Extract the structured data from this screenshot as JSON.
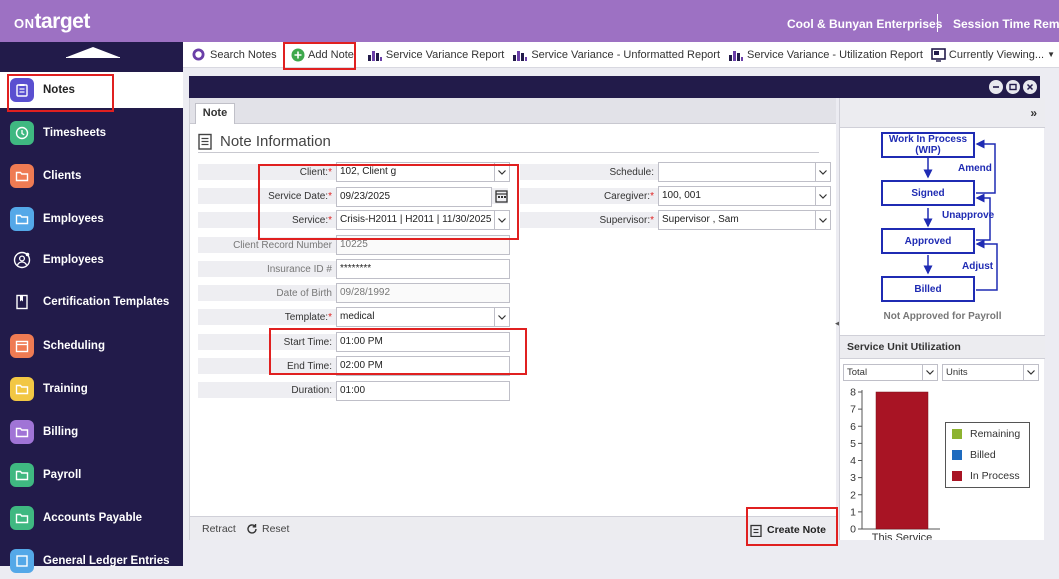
{
  "header": {
    "logo_on": "ON",
    "logo_target": "target",
    "company": "Cool & Bunyan Enterprises",
    "session": "Session Time Remai"
  },
  "sidebar": {
    "items": [
      {
        "label": "Notes",
        "color": "#5a4fd0"
      },
      {
        "label": "Timesheets",
        "color": "#3fb881"
      },
      {
        "label": "Clients",
        "color": "#ef7b53"
      },
      {
        "label": "Employees",
        "color": "#54a8e8"
      },
      {
        "label": "Employees",
        "sub": true
      },
      {
        "label": "Certification Templates",
        "sub": true
      },
      {
        "label": "Scheduling",
        "color": "#ef7b53"
      },
      {
        "label": "Training",
        "color": "#f2c744"
      },
      {
        "label": "Billing",
        "color": "#a074d6"
      },
      {
        "label": "Payroll",
        "color": "#3fb881"
      },
      {
        "label": "Accounts Payable",
        "color": "#3fb881"
      },
      {
        "label": "General Ledger Entries",
        "color": "#54a8e8"
      }
    ]
  },
  "toolbar": {
    "search_notes": "Search Notes",
    "add_note": "Add Note",
    "svc_variance": "Service Variance Report",
    "svc_unformatted": "Service Variance - Unformatted Report",
    "svc_utilization": "Service Variance - Utilization Report",
    "currently_viewing": "Currently Viewing..."
  },
  "form": {
    "tab": "Note",
    "title": "Note Information",
    "fields": {
      "client_label": "Client:",
      "client_value": "102, Client g",
      "service_date_label": "Service Date:",
      "service_date_value": "09/23/2025",
      "service_label": "Service:",
      "service_value": "Crisis-H2011 | H2011 | 11/30/2025",
      "client_record_label": "Client Record Number",
      "client_record_value": "10225",
      "insurance_label": "Insurance ID #",
      "insurance_value": "********",
      "dob_label": "Date of Birth",
      "dob_value": "09/28/1992",
      "template_label": "Template:",
      "template_value": "medical",
      "start_time_label": "Start Time:",
      "start_time_value": "01:00 PM",
      "end_time_label": "End Time:",
      "end_time_value": "02:00 PM",
      "duration_label": "Duration:",
      "duration_value": "01:00",
      "schedule_label": "Schedule:",
      "schedule_value": "",
      "caregiver_label": "Caregiver:",
      "caregiver_value": "100, 001",
      "supervisor_label": "Supervisor:",
      "supervisor_value": "Supervisor , Sam"
    },
    "footer": {
      "retract": "Retract",
      "reset": "Reset",
      "create_note": "Create Note"
    }
  },
  "workflow": {
    "expand": "»",
    "steps": [
      "Work In Process (WIP)",
      "Signed",
      "Approved",
      "Billed"
    ],
    "transitions": [
      "Amend",
      "Unapprove",
      "Adjust"
    ],
    "status": "Not Approved for Payroll"
  },
  "utilization": {
    "title": "Service Unit Utilization",
    "filter1": "Total",
    "filter2": "Units",
    "legend": [
      {
        "label": "Remaining",
        "color": "#8db330"
      },
      {
        "label": "Billed",
        "color": "#1e6bbf"
      },
      {
        "label": "In Process",
        "color": "#a81424"
      }
    ]
  },
  "chart_data": {
    "type": "bar",
    "categories": [
      "This Service"
    ],
    "series": [
      {
        "name": "In Process",
        "values": [
          8
        ]
      }
    ],
    "yticks": [
      "0",
      "1",
      "2",
      "3",
      "4",
      "5",
      "6",
      "7",
      "8"
    ],
    "ylim": [
      0,
      8
    ]
  }
}
